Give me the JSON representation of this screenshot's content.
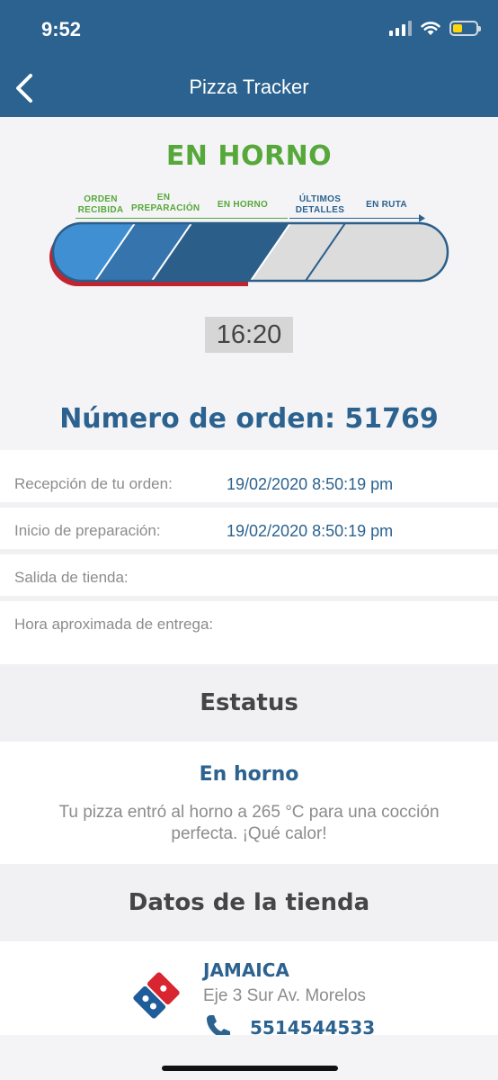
{
  "status_bar": {
    "time": "9:52"
  },
  "nav": {
    "title": "Pizza Tracker"
  },
  "tracker": {
    "stage_title": "EN HORNO",
    "steps": [
      {
        "label1": "ORDEN",
        "label2": "RECIBIDA",
        "done": true
      },
      {
        "label1": "EN",
        "label2": "PREPARACIÓN",
        "done": true
      },
      {
        "label1": "EN HORNO",
        "label2": "",
        "done": true
      },
      {
        "label1": "ÚLTIMOS",
        "label2": "DETALLES",
        "done": false
      },
      {
        "label1": "EN RUTA",
        "label2": "",
        "done": false
      }
    ],
    "progress_steps_completed": 3,
    "progress_steps_total": 5,
    "timer": "16:20",
    "order_label": "Número de orden: 51769"
  },
  "details": [
    {
      "label": "Recepción de tu orden:",
      "value": "19/02/2020 8:50:19 pm"
    },
    {
      "label": "Inicio de preparación:",
      "value": "19/02/2020 8:50:19 pm"
    },
    {
      "label": "Salida de tienda:",
      "value": ""
    },
    {
      "label": "Hora aproximada de entrega:",
      "value": ""
    }
  ],
  "status": {
    "heading": "Estatus",
    "title": "En horno",
    "description": "Tu pizza entró al horno a 265 °C para una cocción perfecta. ¡Qué calor!"
  },
  "store": {
    "heading": "Datos de la tienda",
    "name": "JAMAICA",
    "address": "Eje 3 Sur Av. Morelos",
    "phone": "5514544533"
  },
  "colors": {
    "brand_blue": "#2b628f",
    "green": "#56a83a",
    "red": "#c0252f",
    "done_light": "#3f8fd2",
    "done_mid": "#3574ad",
    "done_dark": "#2b5f8a",
    "todo": "#dcdcdc"
  },
  "icons": [
    "back-chevron-icon",
    "signal-icon",
    "wifi-icon",
    "battery-icon",
    "phone-icon",
    "dominos-logo-icon"
  ]
}
